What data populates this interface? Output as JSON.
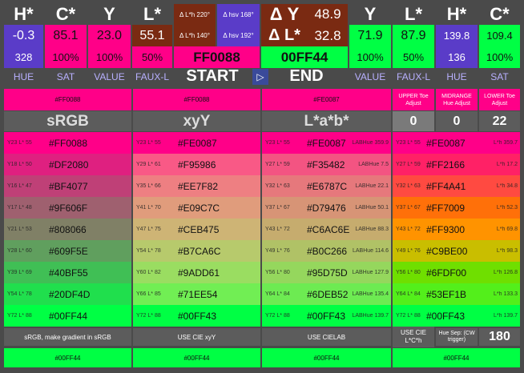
{
  "header": {
    "hstar_left": "H*",
    "cstar_left": "C*",
    "y_left": "Y",
    "lstar_left": "L*",
    "dlh_top": "Δ L*h 220°",
    "dhsv_top": "Δ hsv 168°",
    "delta_y": "Δ Y",
    "delta_y_val": "48.9",
    "y_right": "Y",
    "lstar_right": "L*",
    "hstar_right": "H*",
    "cstar_right": "C*",
    "left_h": "-0.3",
    "left_c": "85.1",
    "left_y": "23.0",
    "left_l": "55.1",
    "dlh_bot": "Δ L*h 140°",
    "dhsv_bot": "Δ hsv 192°",
    "delta_l": "Δ L*",
    "delta_l_val": "32.8",
    "right_y": "71.9",
    "right_l": "87.9",
    "right_h": "139.8",
    "right_c": "109.4",
    "hue_left": "328",
    "sat_left": "100%",
    "val_left": "100%",
    "faux_left": "50%",
    "start_hex": "FF0088",
    "end_hex": "00FF44",
    "val_right": "100%",
    "faux_right": "50%",
    "hue_right": "136",
    "sat_right": "100%",
    "lbl_hue": "HUE",
    "lbl_sat": "SAT",
    "lbl_value": "VALUE",
    "lbl_faux": "FAUX-L",
    "start": "START",
    "end": "END",
    "lbl_value_r": "VALUE",
    "lbl_faux_r": "FAUX-L",
    "lbl_hue_r": "HUE",
    "lbl_sat_r": "SAT"
  },
  "adjust": {
    "hex1": "#FF0088",
    "hex2": "#FF0088",
    "hex3": "#FE0087",
    "upper_toe": "UPPER Toe Adjust",
    "midrange": "MIDRANGE Hue Adjust",
    "lower_toe": "LOWER Toe Adjust",
    "upper_val": "0",
    "mid_val": "0",
    "lower_val": "22"
  },
  "sections": {
    "srgb": "sRGB",
    "xyy": "xyY",
    "lab": "L*a*b*"
  },
  "rows": [
    {
      "c1": "#FF0088",
      "y1": "Y23 L* 55",
      "h1": "#FF0088",
      "c2": "#FF0088",
      "y2": "Y23 L* 55",
      "h2": "#FE0087",
      "c3": "#FF0088",
      "y3": "Y23 L* 55",
      "h3": "#FE0087",
      "lh3": "LABHue 359.9",
      "c4": "#FF0088",
      "y4": "Y23 L* 55",
      "h4": "#FE0087",
      "lh4": "L*h 359.7"
    },
    {
      "c1": "#DF2080",
      "y1": "Y18 L* 50",
      "h1": "#DF2080",
      "c2": "#F95986",
      "y2": "Y29 L* 61",
      "h2": "#F95986",
      "c3": "#F35482",
      "y3": "Y27 L* 59",
      "h3": "#F35482",
      "lh3": "LABHue 7.5",
      "c4": "#FF2166",
      "y4": "Y27 L* 59",
      "h4": "#FF2166",
      "lh4": "L*h 17.2"
    },
    {
      "c1": "#BF4077",
      "y1": "Y16 L* 47",
      "h1": "#BF4077",
      "c2": "#EE7F82",
      "y2": "Y35 L* 66",
      "h2": "#EE7F82",
      "c3": "#E6787C",
      "y3": "Y32 L* 63",
      "h3": "#E6787C",
      "lh3": "LABHue 22.1",
      "c4": "#FF4A41",
      "y4": "Y32 L* 63",
      "h4": "#FF4A41",
      "lh4": "L*h 34.8"
    },
    {
      "c1": "#9F606F",
      "y1": "Y17 L* 48",
      "h1": "#9F606F",
      "c2": "#E09C7C",
      "y2": "Y41 L* 70",
      "h2": "#E09C7C",
      "c3": "#D79476",
      "y3": "Y37 L* 67",
      "h3": "#D79476",
      "lh3": "LABHue 50.1",
      "c4": "#FF7009",
      "y4": "Y37 L* 67",
      "h4": "#FF7009",
      "lh4": "L*h 52.3"
    },
    {
      "c1": "#808066",
      "y1": "Y21 L* 53",
      "h1": "#808066",
      "c2": "#CEB475",
      "y2": "Y47 L* 75",
      "h2": "#CEB475",
      "c3": "#C6AC6E",
      "y3": "Y43 L* 72",
      "h3": "#C6AC6E",
      "lh3": "LABHue 88.3",
      "c4": "#FF9300",
      "y4": "Y43 L* 72",
      "h4": "#FF9300",
      "lh4": "L*h 69.8"
    },
    {
      "c1": "#609F5E",
      "y1": "Y28 L* 60",
      "h1": "#609F5E",
      "c2": "#B7CA6C",
      "y2": "Y54 L* 78",
      "h2": "#B7CA6C",
      "c3": "#B0C266",
      "y3": "Y49 L* 76",
      "h3": "#B0C266",
      "lh3": "LABHue 114.6",
      "c4": "#C9BE00",
      "y4": "Y49 L* 76",
      "h4": "#C9BE00",
      "lh4": "L*h 98.3"
    },
    {
      "c1": "#40BF55",
      "y1": "Y39 L* 69",
      "h1": "#40BF55",
      "c2": "#9ADD61",
      "y2": "Y60 L* 82",
      "h2": "#9ADD61",
      "c3": "#95D75D",
      "y3": "Y56 L* 80",
      "h3": "#95D75D",
      "lh3": "LABHue 127.9",
      "c4": "#6FDF00",
      "y4": "Y56 L* 80",
      "h4": "#6FDF00",
      "lh4": "L*h 126.8"
    },
    {
      "c1": "#20DF4D",
      "y1": "Y54 L* 78",
      "h1": "#20DF4D",
      "c2": "#71EE54",
      "y2": "Y66 L* 85",
      "h2": "#71EE54",
      "c3": "#6DEB52",
      "y3": "Y64 L* 84",
      "h3": "#6DEB52",
      "lh3": "LABHue 135.4",
      "c4": "#53EF1B",
      "y4": "Y64 L* 84",
      "h4": "#53EF1B",
      "lh4": "L*h 133.3"
    },
    {
      "c1": "#00FF44",
      "y1": "Y72 L* 88",
      "h1": "#00FF44",
      "c2": "#00FF44",
      "y2": "Y72 L* 88",
      "h2": "#00FF43",
      "c3": "#00FF44",
      "y3": "Y72 L* 88",
      "h3": "#00FF43",
      "lh3": "LABHue 139.7",
      "c4": "#00FF44",
      "y4": "Y72 L* 88",
      "h4": "#00FF43",
      "lh4": "L*h 139.7"
    }
  ],
  "footer": {
    "srgb_btn": "sRGB, make gradient in  sRGB",
    "xyy_btn": "USE CIE xyY",
    "lab_btn": "USE CIELAB",
    "lch_btn": "USE CIE L*C*h",
    "huesep_label": "Hue Sep: (CW trigger)",
    "huesep_val": "180",
    "hex1": "#00FF44",
    "hex2": "#00FF44",
    "hex3": "#00FF44",
    "hex4": "#00FF44"
  },
  "colors": {
    "start": "#FF0088",
    "end": "#00FF44",
    "purple": "#5a3cc8",
    "dark_red": "#7a2a12"
  }
}
